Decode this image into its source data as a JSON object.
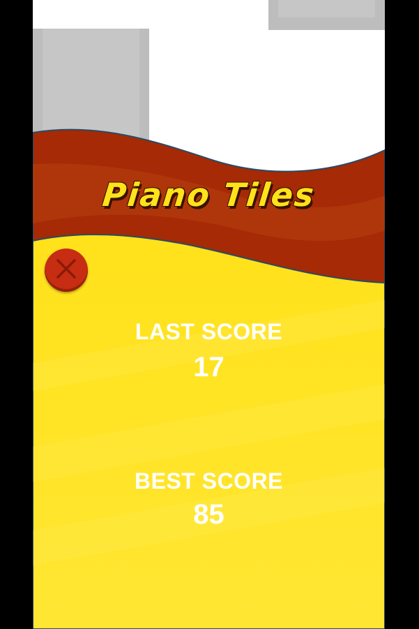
{
  "game": {
    "title": "Piano Tiles",
    "close_icon": "close-icon"
  },
  "scores": {
    "last_label": "LAST SCORE",
    "last_value": "17",
    "best_label": "BEST SCORE",
    "best_value": "85"
  },
  "colors": {
    "tile": "#bdbdbd",
    "banner_dark": "#a52a05",
    "banner_mid": "#b63a0c",
    "panel_yellow": "#ffe21a",
    "close_button": "#c72d12",
    "title_text": "#ffe21a",
    "score_text": "#ffffff",
    "outside": "#000000"
  }
}
